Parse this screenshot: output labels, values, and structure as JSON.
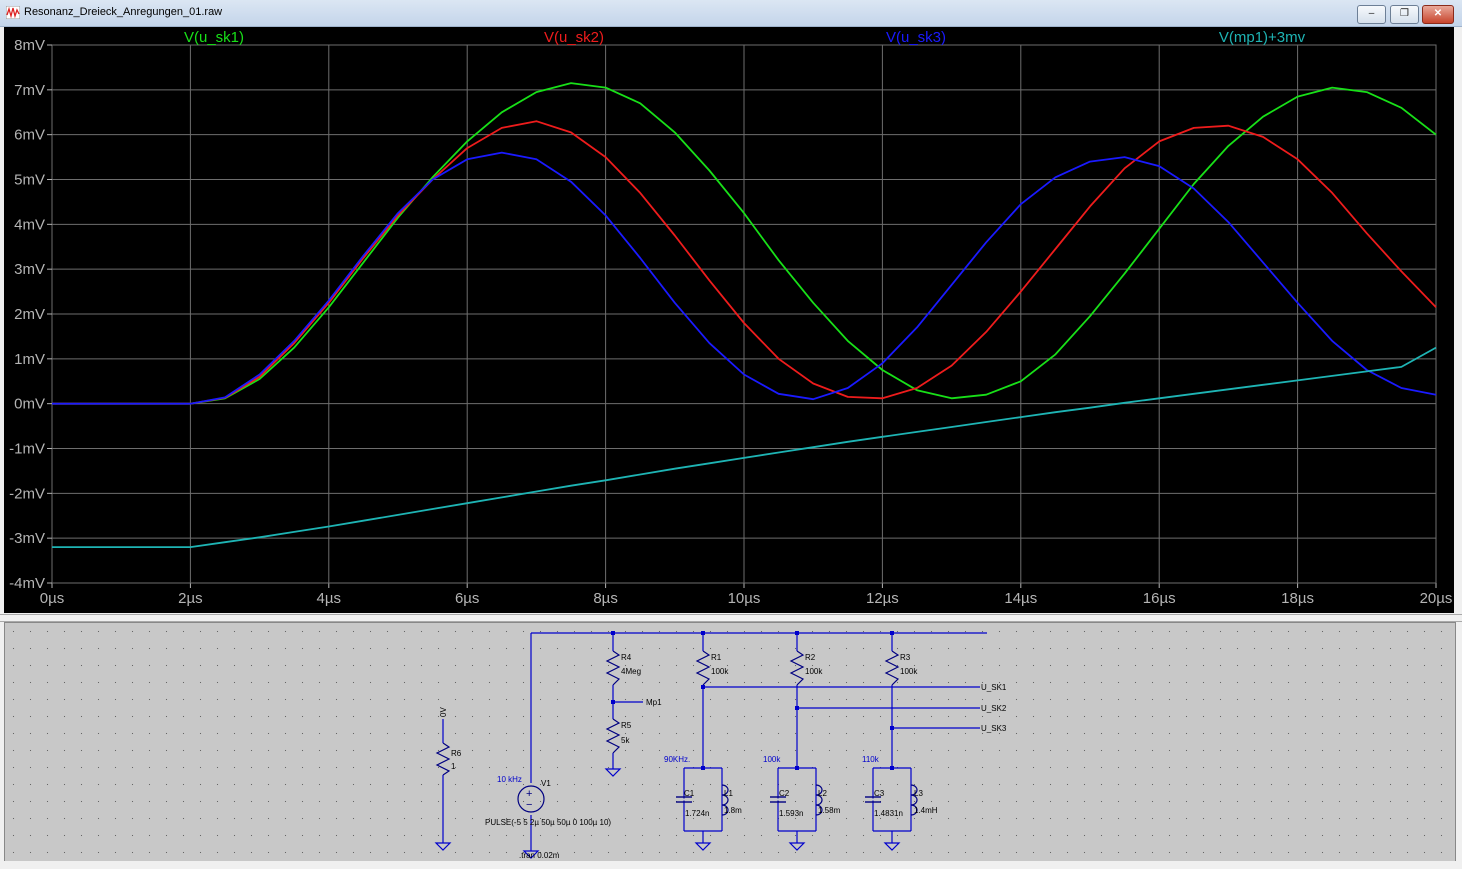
{
  "window": {
    "title": "Resonanz_Dreieck_Anregungen_01.raw",
    "buttons": {
      "minimize": "‒",
      "maximize": "❐",
      "close": "✕"
    }
  },
  "colors": {
    "u_sk1": "#18e018",
    "u_sk2": "#ee1c1c",
    "u_sk3": "#1a1aff",
    "mp1": "#1eb4b4",
    "grid": "#6e6e6e",
    "axis_text": "#b4b4b4",
    "wire": "#0000cc",
    "component": "#0000aa"
  },
  "chart_data": {
    "type": "line",
    "xlabel": "",
    "ylabel": "",
    "xlim": [
      0,
      20
    ],
    "ylim": [
      -4,
      8
    ],
    "x_ticks": [
      0,
      2,
      4,
      6,
      8,
      10,
      12,
      14,
      16,
      18,
      20
    ],
    "x_tick_labels": [
      "0µs",
      "2µs",
      "4µs",
      "6µs",
      "8µs",
      "10µs",
      "12µs",
      "14µs",
      "16µs",
      "18µs",
      "20µs"
    ],
    "y_ticks": [
      8,
      7,
      6,
      5,
      4,
      3,
      2,
      1,
      0,
      -1,
      -2,
      -3,
      -4
    ],
    "y_tick_labels": [
      "8mV",
      "7mV",
      "6mV",
      "5mV",
      "4mV",
      "3mV",
      "2mV",
      "1mV",
      "0mV",
      "-1mV",
      "-2mV",
      "-3mV",
      "-4mV"
    ],
    "grid": true,
    "x": [
      0,
      1,
      2,
      2.5,
      3,
      3.5,
      4,
      4.5,
      5,
      5.5,
      6,
      6.5,
      7,
      7.5,
      8,
      8.5,
      9,
      9.5,
      10,
      10.5,
      11,
      11.5,
      12,
      12.5,
      13,
      13.5,
      14,
      14.5,
      15,
      15.5,
      16,
      16.5,
      17,
      17.5,
      18,
      18.5,
      19,
      19.5,
      20
    ],
    "series": [
      {
        "name": "V(u_sk1)",
        "values": [
          0,
          0,
          0,
          0.12,
          0.55,
          1.25,
          2.15,
          3.15,
          4.15,
          5.05,
          5.85,
          6.5,
          6.95,
          7.15,
          7.05,
          6.7,
          6.05,
          5.2,
          4.25,
          3.2,
          2.25,
          1.4,
          0.75,
          0.3,
          0.12,
          0.2,
          0.5,
          1.1,
          1.95,
          2.9,
          3.9,
          4.9,
          5.75,
          6.4,
          6.85,
          7.05,
          6.95,
          6.6,
          6.0
        ]
      },
      {
        "name": "V(u_sk2)",
        "values": [
          0,
          0,
          0,
          0.13,
          0.6,
          1.35,
          2.25,
          3.25,
          4.2,
          5.0,
          5.7,
          6.15,
          6.3,
          6.05,
          5.5,
          4.7,
          3.75,
          2.75,
          1.8,
          1.0,
          0.45,
          0.15,
          0.12,
          0.35,
          0.85,
          1.6,
          2.5,
          3.45,
          4.4,
          5.25,
          5.85,
          6.15,
          6.2,
          5.95,
          5.45,
          4.7,
          3.8,
          2.95,
          2.15
        ]
      },
      {
        "name": "V(u_sk3)",
        "values": [
          0,
          0,
          0,
          0.14,
          0.65,
          1.4,
          2.3,
          3.3,
          4.25,
          5.0,
          5.45,
          5.6,
          5.45,
          4.95,
          4.2,
          3.25,
          2.25,
          1.35,
          0.65,
          0.22,
          0.1,
          0.35,
          0.9,
          1.7,
          2.65,
          3.6,
          4.45,
          5.05,
          5.4,
          5.5,
          5.3,
          4.8,
          4.05,
          3.15,
          2.25,
          1.4,
          0.75,
          0.35,
          0.2
        ]
      },
      {
        "name": "V(mp1)+3mv",
        "values": [
          -3.2,
          -3.2,
          -3.2,
          -3.09,
          -2.98,
          -2.86,
          -2.74,
          -2.61,
          -2.48,
          -2.35,
          -2.22,
          -2.09,
          -1.96,
          -1.83,
          -1.71,
          -1.58,
          -1.45,
          -1.33,
          -1.21,
          -1.09,
          -0.97,
          -0.85,
          -0.74,
          -0.63,
          -0.52,
          -0.41,
          -0.3,
          -0.19,
          -0.09,
          0.02,
          0.12,
          0.22,
          0.32,
          0.42,
          0.52,
          0.62,
          0.72,
          0.82,
          1.25
        ]
      }
    ]
  },
  "schematic": {
    "labels": {
      "gnd0": "0V",
      "r6": "R6",
      "r6_val": "1",
      "src_freq": "10 kHz",
      "v1": "V1",
      "pulse": "PULSE(-5 5 2µ 50µ 50µ 0 100µ 10)",
      "tran": ".tran 0.02m",
      "r4": "R4",
      "r4_val": "4Meg",
      "mp1": "Mp1",
      "r5": "R5",
      "r5_val": "5k",
      "r1": "R1",
      "r1_val": "100k",
      "r2": "R2",
      "r2_val": "100k",
      "r3": "R3",
      "r3_val": "100k",
      "u_sk1": "U_SK1",
      "u_sk2": "U_SK2",
      "u_sk3": "U_SK3",
      "f1": "90KHz.",
      "f2": "100k",
      "f3": "110k",
      "c1": "C1",
      "c1_val": "1.724n",
      "l1": "L1",
      "l1_val": "1.8m",
      "c2": "C2",
      "c2_val": "1.593n",
      "l2": "L2",
      "l2_val": "1.58m",
      "c3": "C3",
      "c3_val": "1.4831n",
      "l3": "L3",
      "l3_val": "1.4mH"
    }
  }
}
